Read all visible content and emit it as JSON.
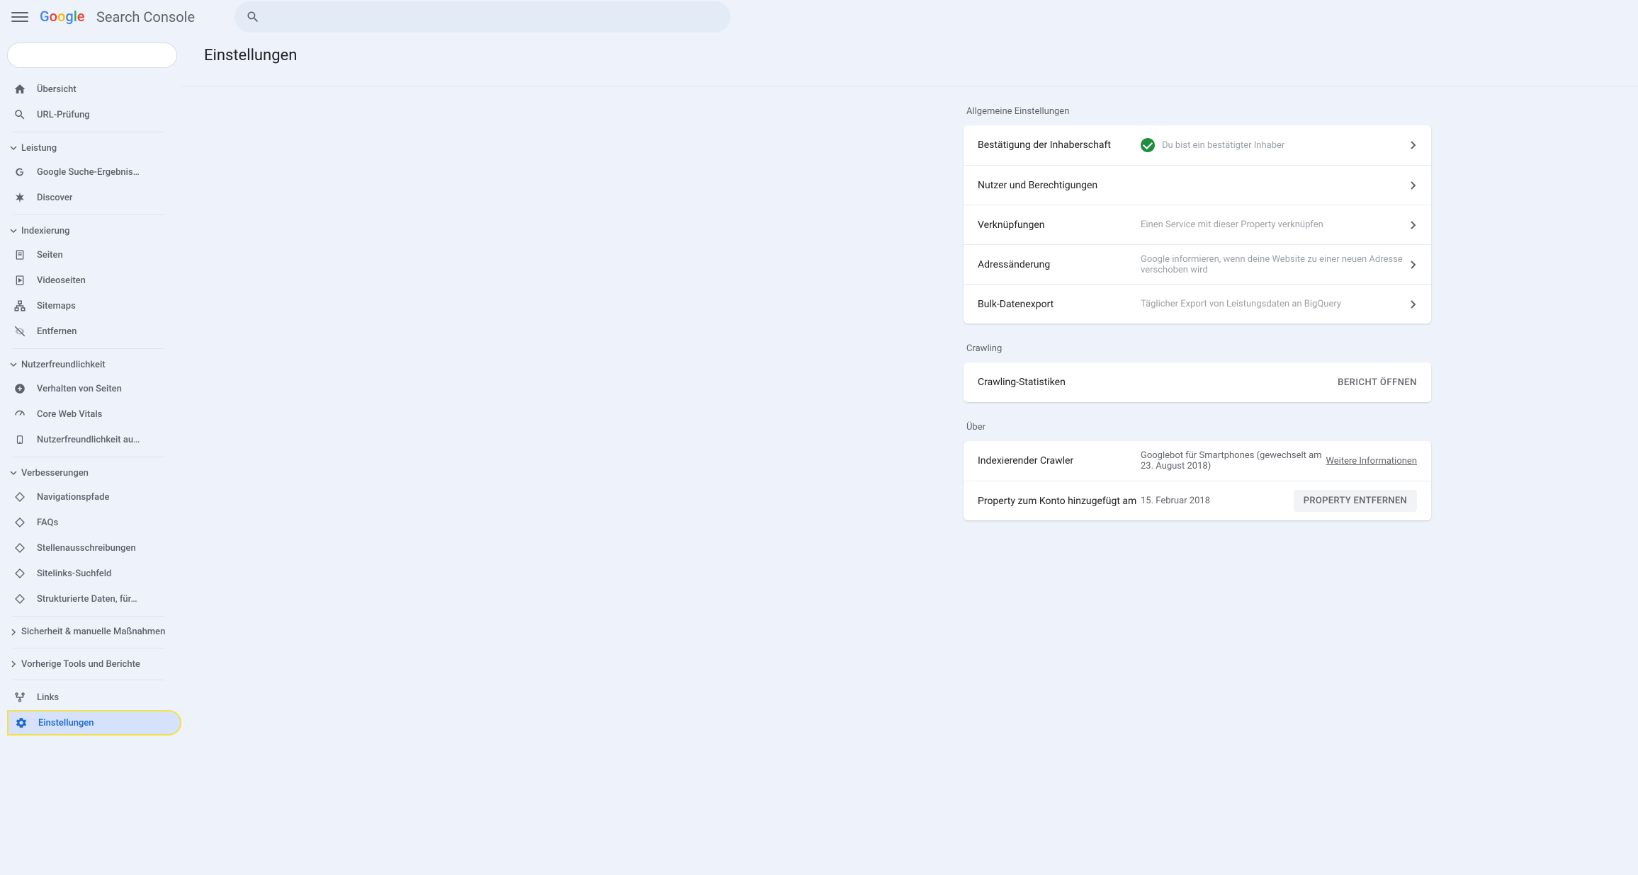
{
  "header": {
    "product_name": "Search Console"
  },
  "sidebar": {
    "overview": "Übersicht",
    "url_inspect": "URL-Prüfung",
    "sect_performance": "Leistung",
    "search_results": "Google Suche-Ergebnis…",
    "discover": "Discover",
    "sect_indexing": "Indexierung",
    "pages": "Seiten",
    "video_pages": "Videoseiten",
    "sitemaps": "Sitemaps",
    "removals": "Entfernen",
    "sect_experience": "Nutzerfreundlichkeit",
    "page_experience": "Verhalten von Seiten",
    "core_vitals": "Core Web Vitals",
    "mobile_usability": "Nutzerfreundlichkeit au…",
    "sect_enhancements": "Verbesserungen",
    "breadcrumbs": "Navigationspfade",
    "faqs": "FAQs",
    "job_postings": "Stellenausschreibungen",
    "sitelinks": "Sitelinks-Suchfeld",
    "structured_data": "Strukturierte Daten, für…",
    "sect_security": "Sicherheit & manuelle Maßnahmen",
    "sect_legacy": "Vorherige Tools und Berichte",
    "links": "Links",
    "settings": "Einstellungen"
  },
  "page": {
    "title": "Einstellungen"
  },
  "general": {
    "section": "Allgemeine Einstellungen",
    "ownership_title": "Bestätigung der Inhaberschaft",
    "ownership_desc": "Du bist ein bestätigter Inhaber",
    "users_title": "Nutzer und Berechtigungen",
    "assoc_title": "Verknüpfungen",
    "assoc_desc": "Einen Service mit dieser Property verknüpfen",
    "addr_title": "Adressänderung",
    "addr_desc": "Google informieren, wenn deine Website zu einer neuen Adresse verschoben wird",
    "bulk_title": "Bulk-Datenexport",
    "bulk_desc": "Täglicher Export von Leistungsdaten an BigQuery"
  },
  "crawling": {
    "section": "Crawling",
    "stats_title": "Crawling-Statistiken",
    "open_report": "BERICHT ÖFFNEN"
  },
  "about": {
    "section": "Über",
    "crawler_title": "Indexierender Crawler",
    "crawler_desc": "Googlebot für Smartphones (gewechselt am 23. August 2018)",
    "more_info": "Weitere Informationen",
    "added_title": "Property zum Konto hinzugefügt am",
    "added_date": "15. Februar 2018",
    "remove": "PROPERTY ENTFERNEN"
  }
}
